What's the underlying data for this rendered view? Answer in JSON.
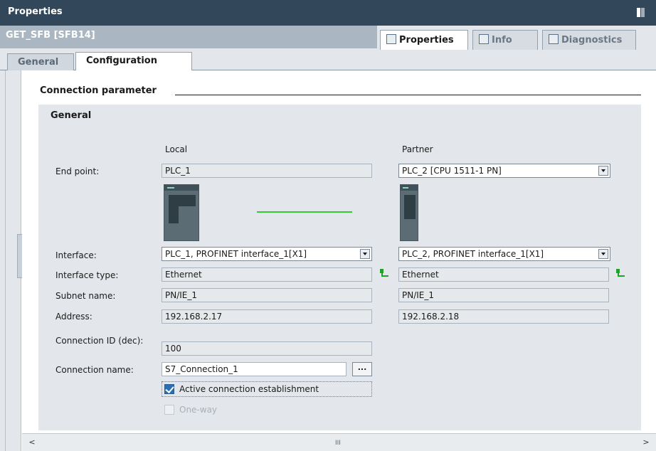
{
  "window": {
    "title": "Properties"
  },
  "object": {
    "title": "GET_SFB [SFB14]"
  },
  "view_tabs": [
    {
      "label": "Properties",
      "icon": "properties-icon"
    },
    {
      "label": "Info",
      "icon": "info-icon"
    },
    {
      "label": "Diagnostics",
      "icon": "diagnostics-icon"
    }
  ],
  "sub_tabs": [
    {
      "label": "General"
    },
    {
      "label": "Configuration"
    }
  ],
  "section": {
    "title": "Connection parameter",
    "group_title": "General",
    "local_header": "Local",
    "partner_header": "Partner"
  },
  "labels": {
    "end_point": "End point:",
    "interface": "Interface:",
    "interface_type": "Interface type:",
    "subnet_name": "Subnet name:",
    "address": "Address:",
    "connection_id": "Connection ID (dec):",
    "connection_name": "Connection name:"
  },
  "local": {
    "end_point": "PLC_1",
    "interface": "PLC_1, PROFINET interface_1[X1]",
    "interface_type": "Ethernet",
    "subnet_name": "PN/IE_1",
    "address": "192.168.2.17"
  },
  "partner": {
    "end_point": "PLC_2 [CPU 1511-1 PN]",
    "interface": "PLC_2, PROFINET interface_1[X1]",
    "interface_type": "Ethernet",
    "subnet_name": "PN/IE_1",
    "address": "192.168.2.18"
  },
  "connection": {
    "id": "100",
    "name": "S7_Connection_1",
    "browse_label": "...",
    "active_establishment": {
      "label": "Active connection establishment",
      "checked": true
    },
    "one_way": {
      "label": "One-way",
      "checked": false,
      "enabled": false
    }
  },
  "scrollbar": {
    "left": "<",
    "right": ">",
    "grip": "III"
  },
  "colors": {
    "titlebar": "#33475a",
    "panel": "#e3e7eb",
    "link_line": "#33cc33",
    "checkbox": "#2a6fb0"
  }
}
